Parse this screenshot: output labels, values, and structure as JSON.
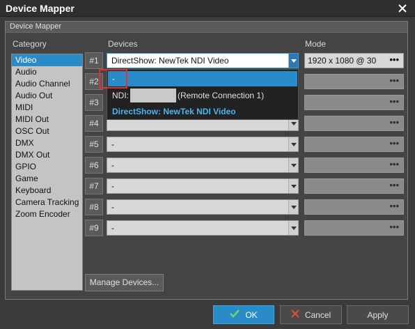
{
  "window": {
    "title": "Device Mapper"
  },
  "group": {
    "title": "Device Mapper"
  },
  "columns": {
    "category": "Category",
    "devices": "Devices",
    "mode": "Mode"
  },
  "categories": [
    "Video",
    "Audio",
    "Audio Channel",
    "Audio Out",
    "MIDI",
    "MIDI Out",
    "OSC Out",
    "DMX",
    "DMX Out",
    "GPIO",
    "Game",
    "Keyboard",
    "Camera Tracking",
    "Zoom Encoder"
  ],
  "selected_category": "Video",
  "rows": [
    {
      "num": "#1",
      "device": "DirectShow: NewTek NDI Video",
      "mode": "1920 x 1080 @ 30",
      "mode_button": "•••"
    },
    {
      "num": "#2",
      "device": "",
      "mode": "",
      "mode_button": "•••"
    },
    {
      "num": "#3",
      "device": "",
      "mode": "",
      "mode_button": "•••"
    },
    {
      "num": "#4",
      "device": "",
      "mode": "",
      "mode_button": "•••"
    },
    {
      "num": "#5",
      "device": "-",
      "mode": "",
      "mode_button": "•••"
    },
    {
      "num": "#6",
      "device": "-",
      "mode": "",
      "mode_button": "•••"
    },
    {
      "num": "#7",
      "device": "-",
      "mode": "",
      "mode_button": "•••"
    },
    {
      "num": "#8",
      "device": "-",
      "mode": "",
      "mode_button": "•••"
    },
    {
      "num": "#9",
      "device": "-",
      "mode": "",
      "mode_button": "•••"
    }
  ],
  "dropdown": {
    "items": [
      {
        "label": "-"
      },
      {
        "prefix": "NDI:",
        "suffix": "(Remote Connection 1)"
      },
      {
        "label": "DirectShow: NewTek NDI Video"
      }
    ]
  },
  "buttons": {
    "manage": "Manage Devices...",
    "ok": "OK",
    "cancel": "Cancel",
    "apply": "Apply"
  },
  "colors": {
    "accent": "#2a8bc9",
    "highlight": "#e03131",
    "ok_icon": "#6fd36f",
    "cancel_icon": "#e04a3a"
  },
  "icons": {
    "close": "close-icon",
    "ok": "checkmark-icon",
    "cancel": "x-icon",
    "dropdown": "chevron-down-icon"
  }
}
